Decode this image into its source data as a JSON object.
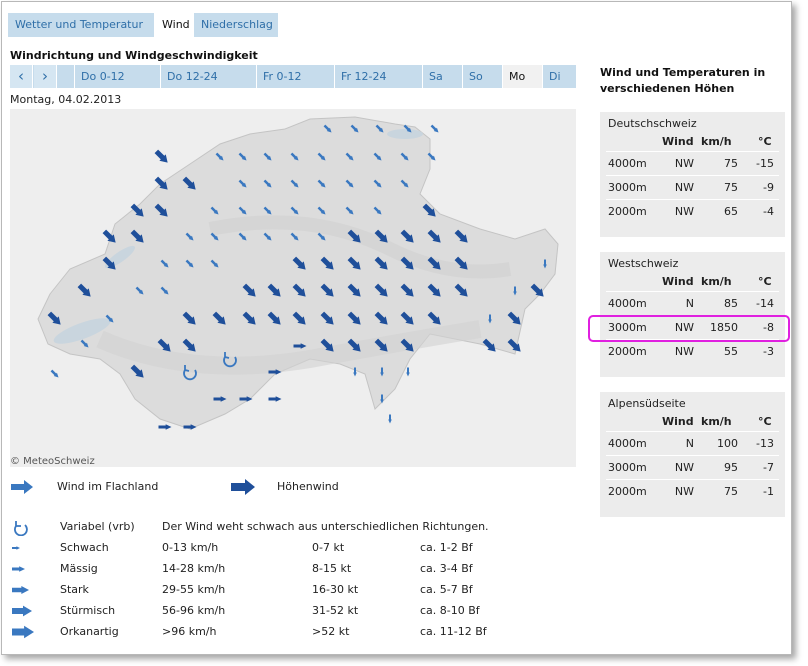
{
  "tabs": [
    "Wetter und Temperatur",
    "Wind",
    "Niederschlag"
  ],
  "active_tab": "Wind",
  "section_title": "Windrichtung und Windgeschwindigkeit",
  "nav": {
    "prev_icon": "chevron-left-icon",
    "next_icon": "chevron-right-icon"
  },
  "days": [
    "Do 0-12",
    "Do 12-24",
    "Fr 0-12",
    "Fr 12-24",
    "Sa",
    "So",
    "Mo",
    "Di"
  ],
  "selected_day": "Mo",
  "date": "Montag, 04.02.2013",
  "copyright": "© MeteoSchweiz",
  "map_legend": {
    "flatland": "Wind im Flachland",
    "altitude": "Höhenwind"
  },
  "intensity_legend": [
    {
      "icon": "variable-wind-icon",
      "name": "Variabel (vrb)",
      "kmh": "Der Wind weht schwach aus unterschiedlichen Richtungen.",
      "kt": "",
      "bf": ""
    },
    {
      "icon": "weak-wind-icon",
      "name": "Schwach",
      "kmh": "0-13 km/h",
      "kt": "0-7 kt",
      "bf": "ca. 1-2 Bf"
    },
    {
      "icon": "moderate-wind-icon",
      "name": "Mässig",
      "kmh": "14-28 km/h",
      "kt": "8-15 kt",
      "bf": "ca. 3-4 Bf"
    },
    {
      "icon": "strong-wind-icon",
      "name": "Stark",
      "kmh": "29-55 km/h",
      "kt": "16-30 kt",
      "bf": "ca. 5-7 Bf"
    },
    {
      "icon": "stormy-wind-icon",
      "name": "Stürmisch",
      "kmh": "56-96 km/h",
      "kt": "31-52 kt",
      "bf": "ca. 8-10 Bf"
    },
    {
      "icon": "hurricane-wind-icon",
      "name": "Orkanartig",
      "kmh": ">96 km/h",
      "kt": ">52 kt",
      "bf": "ca. 11-12 Bf"
    }
  ],
  "right_panel": {
    "title": "Wind und Temperaturen in verschiedenen Höhen",
    "headers": {
      "wind": "Wind",
      "speed": "km/h",
      "temp": "°C"
    },
    "regions": [
      {
        "name": "Deutschschweiz",
        "rows": [
          {
            "alt": "4000m",
            "dir": "NW",
            "speed": "75",
            "temp": "-15"
          },
          {
            "alt": "3000m",
            "dir": "NW",
            "speed": "75",
            "temp": "-9"
          },
          {
            "alt": "2000m",
            "dir": "NW",
            "speed": "65",
            "temp": "-4"
          }
        ]
      },
      {
        "name": "Westschweiz",
        "rows": [
          {
            "alt": "4000m",
            "dir": "N",
            "speed": "85",
            "temp": "-14"
          },
          {
            "alt": "3000m",
            "dir": "NW",
            "speed": "1850",
            "temp": "-8"
          },
          {
            "alt": "2000m",
            "dir": "NW",
            "speed": "55",
            "temp": "-3"
          }
        ]
      },
      {
        "name": "Alpensüdseite",
        "rows": [
          {
            "alt": "4000m",
            "dir": "N",
            "speed": "100",
            "temp": "-13"
          },
          {
            "alt": "3000m",
            "dir": "NW",
            "speed": "95",
            "temp": "-7"
          },
          {
            "alt": "2000m",
            "dir": "NW",
            "speed": "75",
            "temp": "-1"
          }
        ]
      }
    ]
  },
  "colors": {
    "tab_bg": "#c6dcec",
    "link": "#2f6fa8",
    "arrow_dark": "#1f4f9a",
    "arrow_light": "#3a78c0",
    "highlight": "#e020e0"
  }
}
